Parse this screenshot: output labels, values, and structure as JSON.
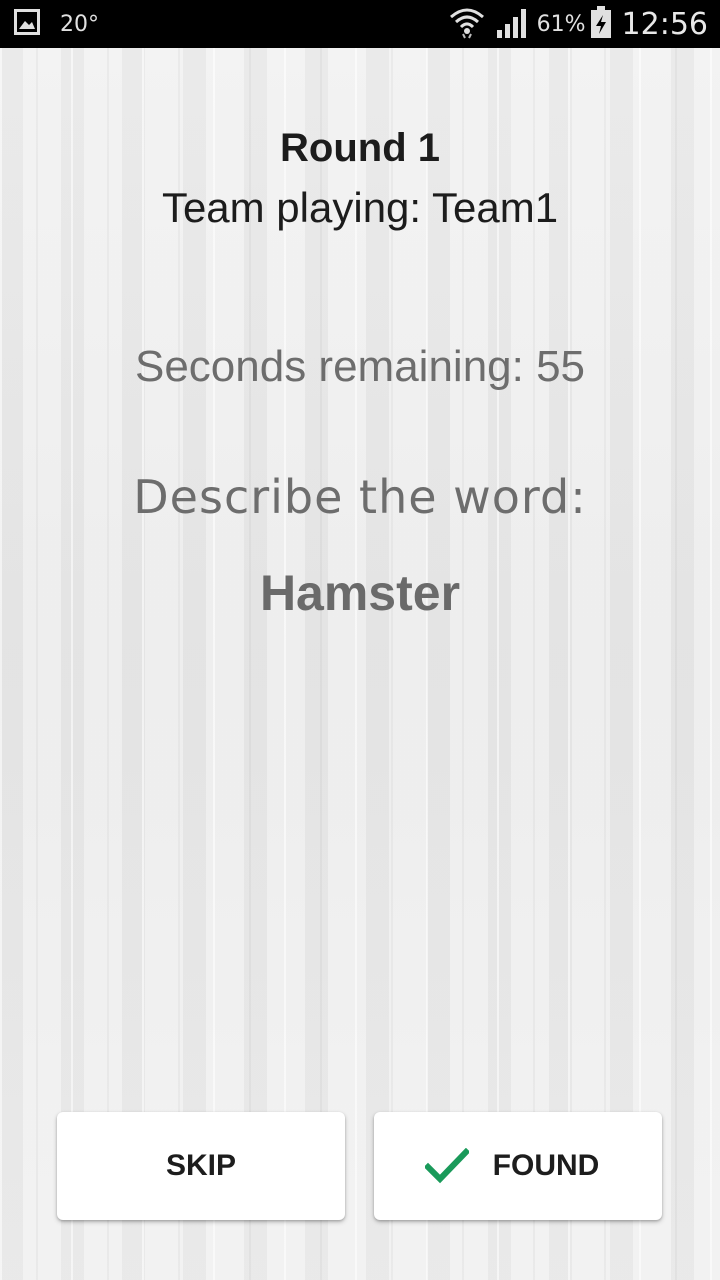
{
  "status_bar": {
    "temperature": "20°",
    "battery_percent": "61%",
    "time": "12:56",
    "icons": [
      "gallery-icon",
      "wifi-icon",
      "signal-icon",
      "battery-icon"
    ]
  },
  "game": {
    "round_title": "Round 1",
    "team_playing": "Team playing: Team1",
    "seconds_remaining": "Seconds remaining: 55",
    "describe_prompt": "Describe the word:",
    "word": "Hamster"
  },
  "buttons": {
    "skip_label": "SKIP",
    "found_label": "FOUND"
  },
  "colors": {
    "check_green": "#1a9a5a",
    "status_bar_bg": "#000000"
  }
}
